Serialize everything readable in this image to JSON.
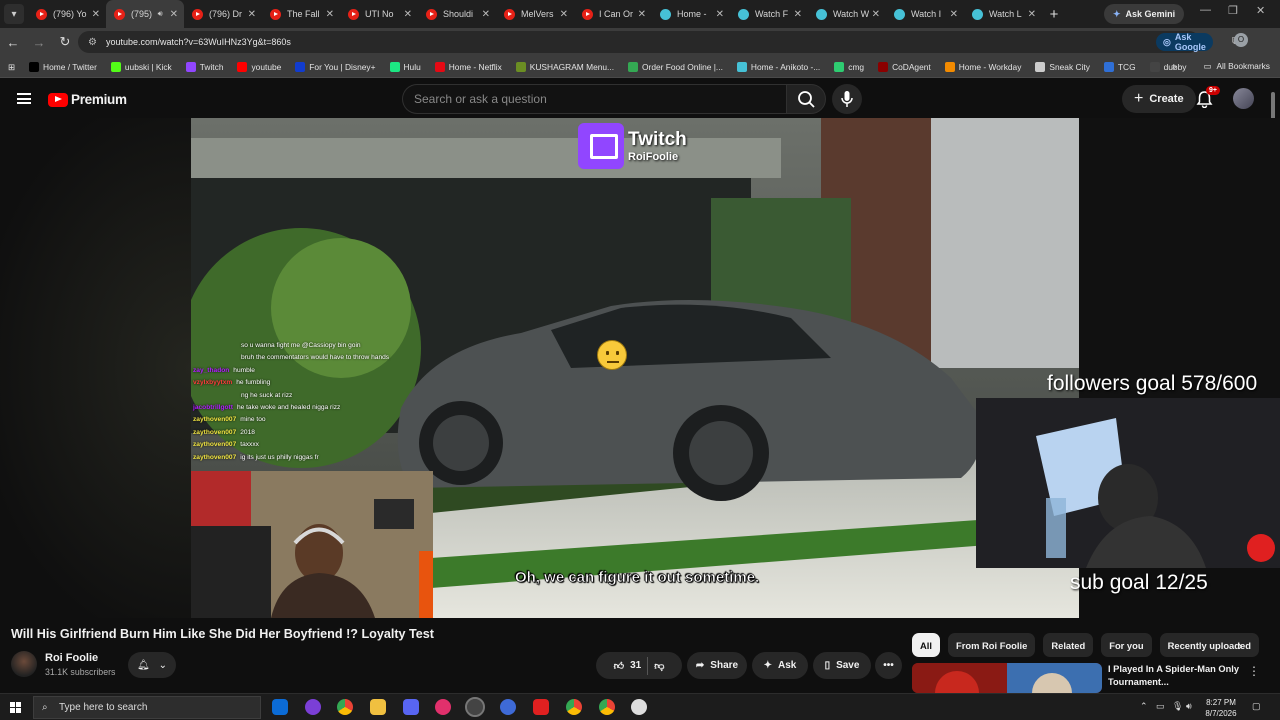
{
  "browser": {
    "tabs": [
      {
        "label": "(796) Yo",
        "favicon": "youtube-icon",
        "active": false
      },
      {
        "label": "(795)",
        "favicon": "youtube-icon",
        "active": true,
        "audio": true
      },
      {
        "label": "(796) Dr",
        "favicon": "youtube-icon",
        "active": false
      },
      {
        "label": "The Fall",
        "favicon": "youtube-icon",
        "active": false
      },
      {
        "label": "UTI No",
        "favicon": "youtube-icon",
        "active": false
      },
      {
        "label": "Shouldi",
        "favicon": "youtube-icon",
        "active": false
      },
      {
        "label": "MelVers",
        "favicon": "youtube-icon",
        "active": false
      },
      {
        "label": "I Can Or",
        "favicon": "youtube-icon",
        "active": false
      },
      {
        "label": "Home -",
        "favicon": "watch-icon",
        "active": false
      },
      {
        "label": "Watch F",
        "favicon": "watch-icon",
        "active": false
      },
      {
        "label": "Watch W",
        "favicon": "watch-icon",
        "active": false
      },
      {
        "label": "Watch I",
        "favicon": "watch-icon",
        "active": false
      },
      {
        "label": "Watch L",
        "favicon": "watch-icon",
        "active": false
      }
    ],
    "ask_gemini": "Ask Gemini",
    "url": "youtube.com/watch?v=63WuIHNz3Yg&t=860s",
    "ask_google": "Ask Google",
    "profile_initial": "O",
    "bookmarks": [
      {
        "label": "Home / Twitter",
        "color": "#000000"
      },
      {
        "label": "uubski | Kick",
        "color": "#53fc18"
      },
      {
        "label": "Twitch",
        "color": "#9146ff"
      },
      {
        "label": "youtube",
        "color": "#ff0000"
      },
      {
        "label": "For You | Disney+",
        "color": "#113ccf"
      },
      {
        "label": "Hulu",
        "color": "#1ce783"
      },
      {
        "label": "Home - Netflix",
        "color": "#e50914"
      },
      {
        "label": "KUSHAGRAM Menu...",
        "color": "#6b8e23"
      },
      {
        "label": "Order Food Online |...",
        "color": "#34a853"
      },
      {
        "label": "Home - Anikoto -...",
        "color": "#46c1d6"
      },
      {
        "label": "cmg",
        "color": "#2ecc71"
      },
      {
        "label": "CoDAgent",
        "color": "#8b0000"
      },
      {
        "label": "Home - Workday",
        "color": "#f38b00"
      },
      {
        "label": "Sneak City",
        "color": "#cccccc"
      },
      {
        "label": "TCG",
        "color": "#2f6fd6"
      },
      {
        "label": "dubby",
        "color": "#444444"
      }
    ],
    "all_bookmarks": "All Bookmarks"
  },
  "youtube": {
    "logo_text": "Premium",
    "search_placeholder": "Search or ask a question",
    "create_label": "Create",
    "notification_count": "9+",
    "video_overlay": {
      "twitch_name": "Twitch",
      "twitch_channel": "RoiFoolie",
      "subtitle": "Oh, we can figure it out sometime.",
      "followers_goal": "followers goal 578/600",
      "sub_goal": "sub goal 12/25",
      "chat": [
        {
          "user": "",
          "msg": "so u wanna fight me @Cassiopy bin goin",
          "color": "#ffffff"
        },
        {
          "user": "",
          "msg": "bruh the commentators would have to throw hands",
          "color": "#ffffff"
        },
        {
          "user": "zay_thadon",
          "msg": "humble",
          "color": "#b01cff"
        },
        {
          "user": "vzylxbyytxm",
          "msg": "he fumbling",
          "color": "#ff3b3b"
        },
        {
          "user": "",
          "msg": "ng he suck at rizz",
          "color": "#ffffff"
        },
        {
          "user": "jacobtrillgott",
          "msg": "he take woke and healed nigga rizz",
          "color": "#b01cff"
        },
        {
          "user": "zaythoven007",
          "msg": "mine too",
          "color": "#f0e442"
        },
        {
          "user": "zaythoven007",
          "msg": "2018",
          "color": "#f0e442"
        },
        {
          "user": "zaythoven007",
          "msg": "taxxxx",
          "color": "#f0e442"
        },
        {
          "user": "zaythoven007",
          "msg": "ig its just us philly niggas fr",
          "color": "#f0e442"
        }
      ]
    },
    "video_title": "Will His Girlfriend Burn Him Like She Did Her Boyfriend !? Loyalty Test",
    "channel_name": "Roi Foolie",
    "subscribers": "31.1K subscribers",
    "like_count": "31",
    "share_label": "Share",
    "ask_label": "Ask",
    "save_label": "Save",
    "chips": [
      "All",
      "From Roi Foolie",
      "Related",
      "For you",
      "Recently uploaded"
    ],
    "recommendation": {
      "title": "I Played In A Spider-Man Only Tournament..."
    }
  },
  "taskbar": {
    "search_placeholder": "Type here to search",
    "time": "8:27 PM",
    "date": "8/7/2026"
  }
}
